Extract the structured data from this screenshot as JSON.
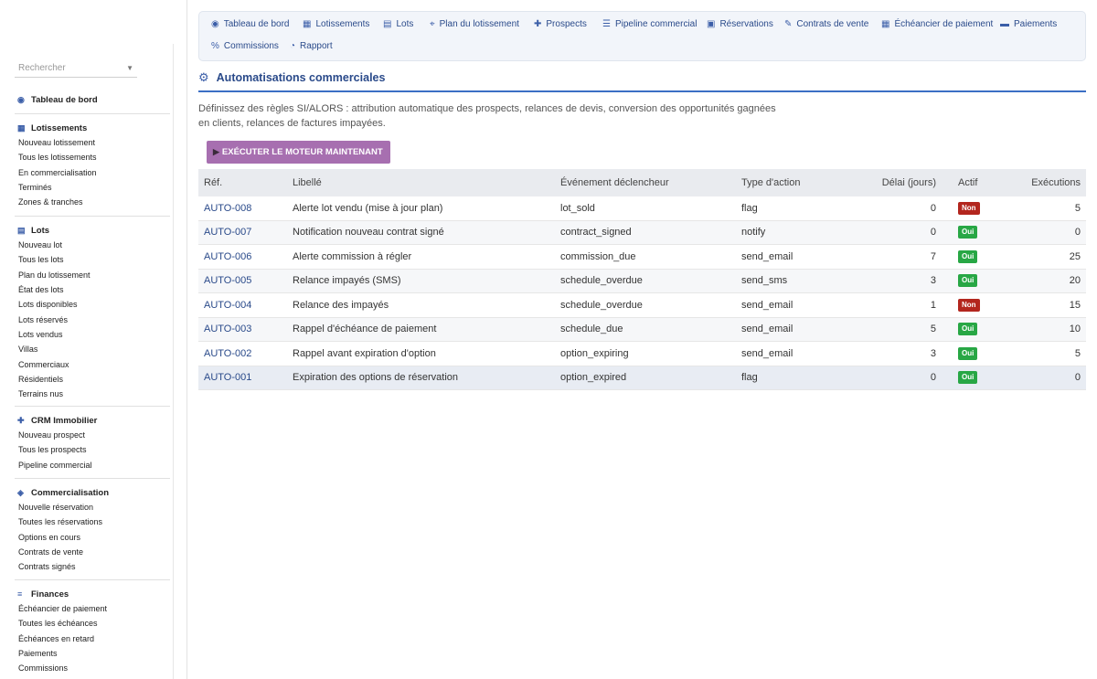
{
  "search": {
    "placeholder": "Rechercher"
  },
  "sidebar": {
    "dashboard": {
      "label": "Tableau de bord",
      "icon": "gauge-icon"
    },
    "sections": [
      {
        "title": "Lotissements",
        "icon": "city-icon",
        "items": [
          "Nouveau lotissement",
          "Tous les lotissements",
          "En commercialisation",
          "Terminés",
          "Zones & tranches"
        ]
      },
      {
        "title": "Lots",
        "icon": "map-icon",
        "items": [
          "Nouveau lot",
          "Tous les lots",
          "Plan du lotissement",
          "État des lots",
          "Lots disponibles",
          "Lots réservés",
          "Lots vendus",
          "Villas",
          "Commerciaux",
          "Résidentiels",
          "Terrains nus"
        ]
      },
      {
        "title": "CRM Immobilier",
        "icon": "user-plus-icon",
        "items": [
          "Nouveau prospect",
          "Tous les prospects",
          "Pipeline commercial"
        ]
      },
      {
        "title": "Commercialisation",
        "icon": "handshake-icon",
        "items": [
          "Nouvelle réservation",
          "Toutes les réservations",
          "Options en cours",
          "Contrats de vente",
          "Contrats signés"
        ]
      },
      {
        "title": "Finances",
        "icon": "coins-icon",
        "items": [
          "Échéancier de paiement",
          "Toutes les échéances",
          "Échéances en retard",
          "Paiements",
          "Commissions"
        ]
      }
    ]
  },
  "topnav": {
    "items": [
      {
        "label": "Tableau de bord",
        "icon": "gauge-icon"
      },
      {
        "label": "Lotissements",
        "icon": "city-icon"
      },
      {
        "label": "Lots",
        "icon": "map-icon"
      },
      {
        "label": "Plan du lotissement",
        "icon": "map-pin-icon"
      },
      {
        "label": "Prospects",
        "icon": "user-plus-icon"
      },
      {
        "label": "Pipeline commercial",
        "icon": "bars-icon"
      },
      {
        "label": "Réservations",
        "icon": "calendar-check-icon"
      },
      {
        "label": "Contrats de vente",
        "icon": "file-signature-icon"
      },
      {
        "label": "Échéancier de paiement",
        "icon": "calendar-icon"
      },
      {
        "label": "Paiements",
        "icon": "money-icon"
      },
      {
        "label": "Commissions",
        "icon": "percent-icon"
      },
      {
        "label": "Rapport",
        "icon": "chart-pie-icon"
      }
    ]
  },
  "page": {
    "title": "Automatisations commerciales",
    "icon": "robot-icon",
    "description": "Définissez des règles SI/ALORS : attribution automatique des prospects, relances de devis, conversion des opportunités gagnées en clients, relances de factures impayées.",
    "run_button": "EXÉCUTER LE MOTEUR MAINTENANT"
  },
  "table": {
    "headers": {
      "ref": "Réf.",
      "libelle": "Libellé",
      "evenement": "Événement déclencheur",
      "type": "Type d'action",
      "delai": "Délai (jours)",
      "actif": "Actif",
      "executions": "Exécutions"
    },
    "rows": [
      {
        "ref": "AUTO-008",
        "libelle": "Alerte lot vendu (mise à jour plan)",
        "evenement": "lot_sold",
        "type": "flag",
        "delai": "0",
        "actif": "Non",
        "executions": "5"
      },
      {
        "ref": "AUTO-007",
        "libelle": "Notification nouveau contrat signé",
        "evenement": "contract_signed",
        "type": "notify",
        "delai": "0",
        "actif": "Oui",
        "executions": "0"
      },
      {
        "ref": "AUTO-006",
        "libelle": "Alerte commission à régler",
        "evenement": "commission_due",
        "type": "send_email",
        "delai": "7",
        "actif": "Oui",
        "executions": "25"
      },
      {
        "ref": "AUTO-005",
        "libelle": "Relance impayés (SMS)",
        "evenement": "schedule_overdue",
        "type": "send_sms",
        "delai": "3",
        "actif": "Oui",
        "executions": "20"
      },
      {
        "ref": "AUTO-004",
        "libelle": "Relance des impayés",
        "evenement": "schedule_overdue",
        "type": "send_email",
        "delai": "1",
        "actif": "Non",
        "executions": "15"
      },
      {
        "ref": "AUTO-003",
        "libelle": "Rappel d'échéance de paiement",
        "evenement": "schedule_due",
        "type": "send_email",
        "delai": "5",
        "actif": "Oui",
        "executions": "10"
      },
      {
        "ref": "AUTO-002",
        "libelle": "Rappel avant expiration d'option",
        "evenement": "option_expiring",
        "type": "send_email",
        "delai": "3",
        "actif": "Oui",
        "executions": "5"
      },
      {
        "ref": "AUTO-001",
        "libelle": "Expiration des options de réservation",
        "evenement": "option_expired",
        "type": "flag",
        "delai": "0",
        "actif": "Oui",
        "executions": "0"
      }
    ]
  },
  "colors": {
    "accent": "#3b6fc4",
    "button": "#a76fb0",
    "badge_yes": "#28a745",
    "badge_no": "#b3261e"
  }
}
